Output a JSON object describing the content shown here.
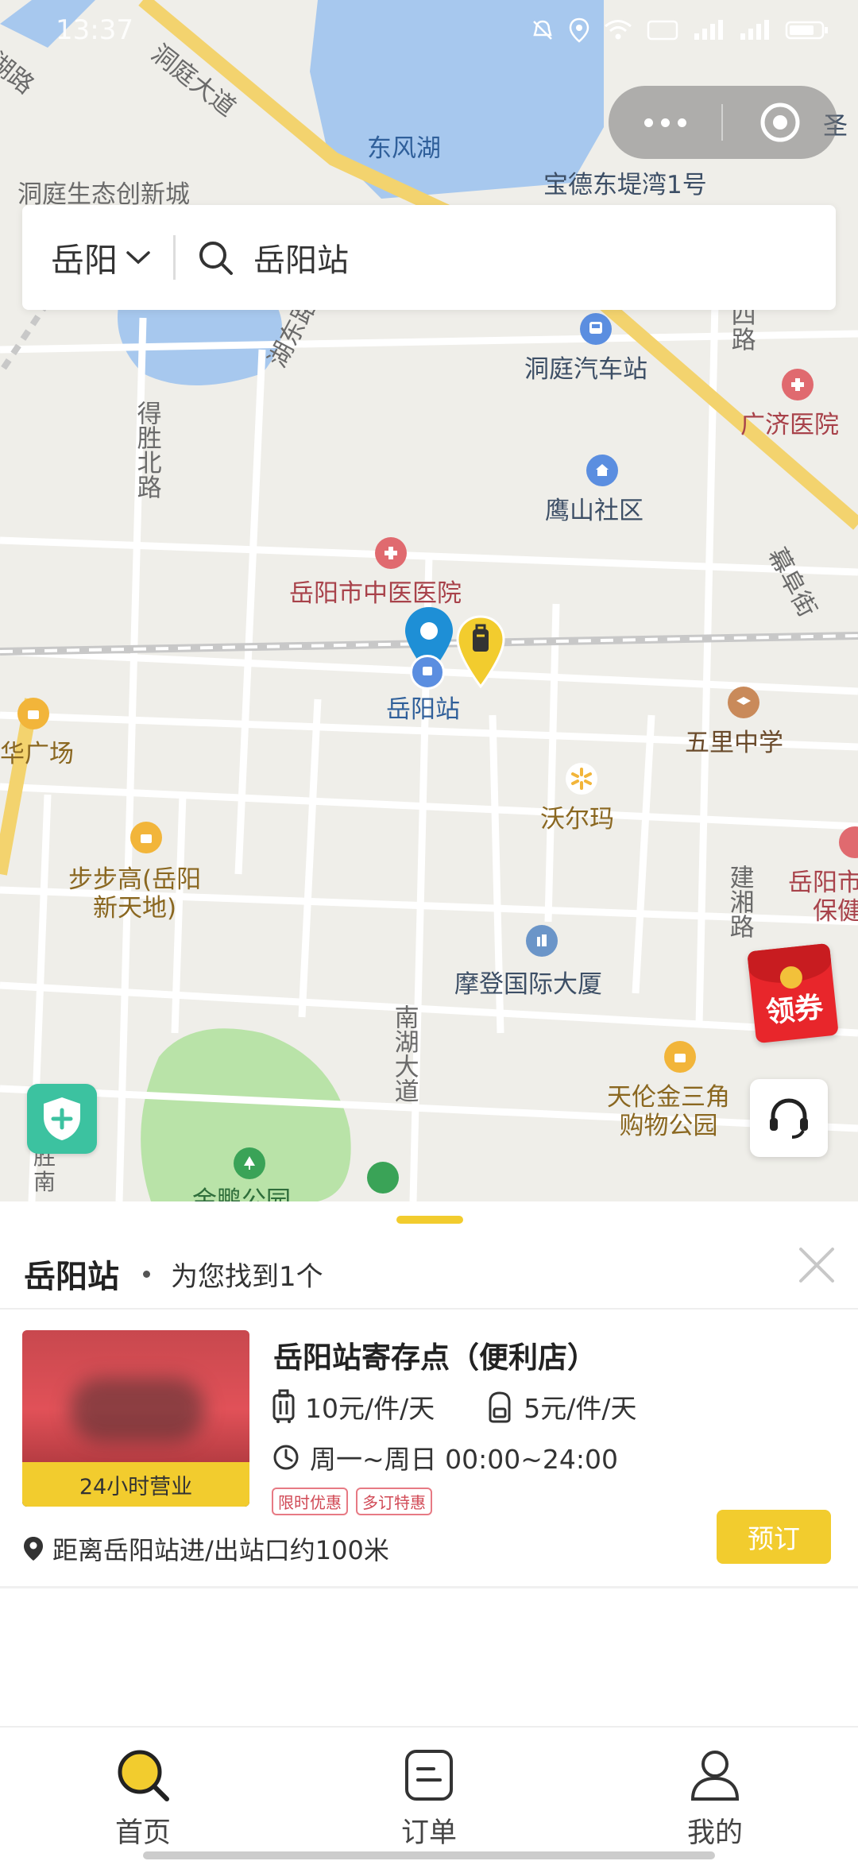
{
  "status_bar": {
    "time": "13:37"
  },
  "search": {
    "city": "岳阳",
    "query": "岳阳站"
  },
  "map": {
    "labels": {
      "dongfeng_lake": "东风湖",
      "baode": "宝德东堤湾1号",
      "sheng": "圣",
      "dongting_road": "洞庭大道",
      "hu_road": "湖路",
      "eco_city": "洞庭生态创新城",
      "bus_station": "洞庭汽车站",
      "guangji": "广济医院",
      "si_road": "四路",
      "desheng": "得胜北路",
      "hudong": "湖东路",
      "yingshan": "鹰山社区",
      "tcm_hospital": "岳阳市中医医院",
      "station": "岳阳站",
      "kaoyu": "幕阜街",
      "wuli": "五里中学",
      "hua_plaza": "华广场",
      "walmart": "沃尔玛",
      "bubugao": "步步高(岳阳\n新天地)",
      "jianxiang": "建湘路",
      "yueyang_bao": "岳阳市\n保健",
      "modern": "摩登国际大厦",
      "nanhu": "南湖大道",
      "tianlun": "天伦金三角\n购物公园",
      "sheng_nan": "胜\n南",
      "jinpeng": "金鹏公园"
    },
    "coupon_label": "领券"
  },
  "sheet": {
    "title": "岳阳站",
    "found_text": "为您找到1个"
  },
  "store": {
    "name": "岳阳站寄存点（便利店）",
    "badge": "24小时营业",
    "price_luggage": "10元/件/天",
    "price_bag": "5元/件/天",
    "hours": "周一~周日 00:00~24:00",
    "tags": [
      "限时优惠",
      "多订特惠"
    ],
    "distance": "距离岳阳站进/出站口约100米",
    "book_label": "预订"
  },
  "tabs": [
    {
      "label": "首页",
      "icon": "search-icon",
      "active": true
    },
    {
      "label": "订单",
      "icon": "order-icon",
      "active": false
    },
    {
      "label": "我的",
      "icon": "user-icon",
      "active": false
    }
  ],
  "colors": {
    "accent": "#f2cc2e",
    "map_pin": "#1e8fd6",
    "water": "#a7c8ee",
    "park": "#b9e3a8"
  }
}
